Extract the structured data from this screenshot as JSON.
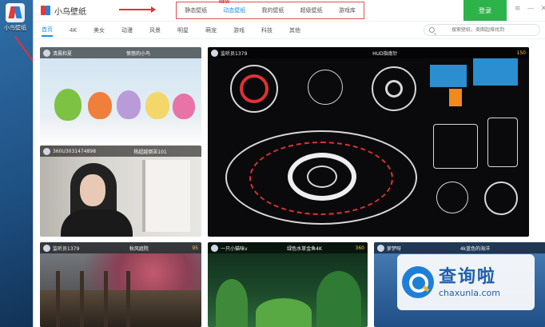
{
  "desktop": {
    "icon_label": "小鸟壁纸"
  },
  "app": {
    "brand": "小鸟壁纸"
  },
  "topnav": {
    "items": [
      {
        "label": "静态壁纸"
      },
      {
        "label": "动态壁纸",
        "active": true
      },
      {
        "label": "我的壁纸"
      },
      {
        "label": "超级壁纸"
      },
      {
        "label": "游戏库"
      }
    ],
    "new_badge": "NEW"
  },
  "login_label": "登录",
  "window_controls": {
    "menu": "≡",
    "minimize": "—",
    "close": "✕"
  },
  "categories": [
    {
      "label": "首页",
      "active": true
    },
    {
      "label": "4K"
    },
    {
      "label": "美女"
    },
    {
      "label": "动漫"
    },
    {
      "label": "风景"
    },
    {
      "label": "明星"
    },
    {
      "label": "萌宠"
    },
    {
      "label": "游戏"
    },
    {
      "label": "科技"
    },
    {
      "label": "其他"
    }
  ],
  "search": {
    "placeholder": "搜索壁纸，美图超难找到"
  },
  "cards": [
    {
      "user": "清晨和夏",
      "title": "愤怒的小鸟",
      "count": ""
    },
    {
      "user": "360U3031474898",
      "title": "杨超越倒苦101",
      "count": ""
    },
    {
      "user": "监听员1379",
      "title": "HUD指南针",
      "count": "150"
    },
    {
      "user": "监听员1379",
      "title": "秋风庭院",
      "count": "95"
    },
    {
      "user": "一只小猫咪v",
      "title": "绿色水草金鱼4K",
      "count": "360"
    },
    {
      "user": "萝梦呀",
      "title": "4k蓝色的海洋",
      "count": ""
    }
  ],
  "watermark": {
    "cn": "查询啦",
    "en": "chaxunla.com"
  },
  "colors": {
    "accent": "#1a8fe8",
    "login": "#2cb34a",
    "annotation": "#e03333"
  }
}
